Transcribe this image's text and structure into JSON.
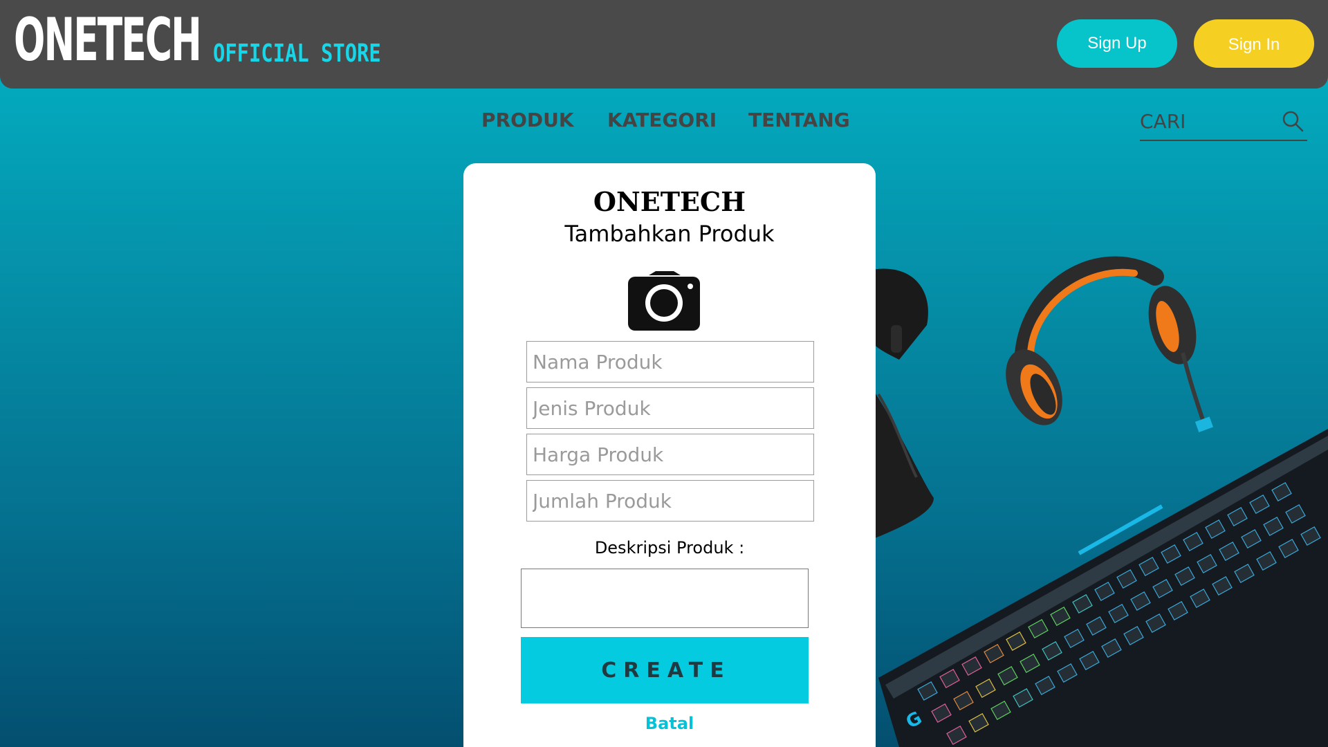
{
  "header": {
    "brand_name": "ONETECH",
    "brand_tagline": "OFFICIAL STORE",
    "signup_label": "Sign Up",
    "signin_label": "Sign In"
  },
  "nav": {
    "items": [
      {
        "label": "PRODUK"
      },
      {
        "label": "KATEGORI"
      },
      {
        "label": "TENTANG"
      }
    ],
    "search_placeholder": "CARI",
    "search_icon": "search-icon"
  },
  "form": {
    "title": "ONETECH",
    "subtitle": "Tambahkan Produk",
    "upload_icon": "camera-icon",
    "fields": [
      {
        "placeholder": "Nama Produk",
        "value": ""
      },
      {
        "placeholder": "Jenis Produk",
        "value": ""
      },
      {
        "placeholder": "Harga Produk",
        "value": ""
      },
      {
        "placeholder": "Jumlah Produk",
        "value": ""
      }
    ],
    "description_label": "Deskripsi Produk :",
    "description_value": "",
    "create_label": "CREATE",
    "cancel_label": "Batal"
  },
  "colors": {
    "header_bg": "#4a4a4a",
    "accent_cyan": "#04cbe0",
    "signin_yellow": "#f5d023",
    "background_top": "#02b4c6",
    "background_bottom": "#044f70"
  }
}
